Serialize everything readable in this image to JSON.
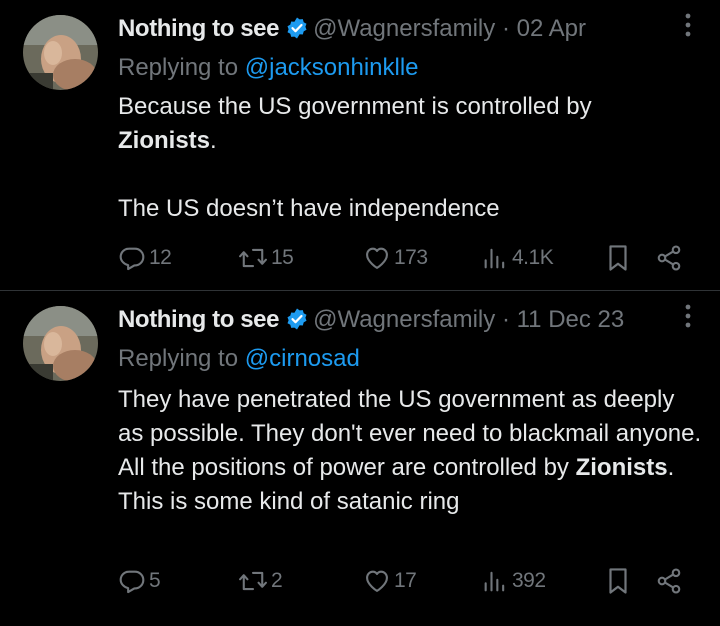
{
  "tweets": [
    {
      "author_name": "Nothing to see",
      "handle": "@Wagnersfamily",
      "separator": "·",
      "date": "02 Apr",
      "reply_prefix": "Replying to",
      "reply_to": "@jacksonhinklle",
      "body": {
        "line1": "Because the US government is controlled by",
        "bold": "Zionists",
        "after_bold": ".",
        "para2": "The US doesn’t have independence"
      },
      "stats": {
        "replies": "12",
        "reposts": "15",
        "likes": "173",
        "views": "4.1K"
      }
    },
    {
      "author_name": "Nothing to see",
      "handle": "@Wagnersfamily",
      "separator": "·",
      "date": "11 Dec 23",
      "reply_prefix": "Replying to",
      "reply_to": "@cirnosad",
      "body": {
        "before_bold": "They have penetrated the US government as deeply as possible. They don't ever need to blackmail anyone. All the positions of power are controlled by ",
        "bold": "Zionists",
        "after_bold": ". This is some kind of satanic ring"
      },
      "stats": {
        "replies": "5",
        "reposts": "2",
        "likes": "17",
        "views": "392"
      }
    }
  ],
  "icons": {
    "verified": "verified-badge-icon",
    "more": "more-options-icon",
    "reply": "reply-icon",
    "repost": "repost-icon",
    "like": "like-icon",
    "views": "views-icon",
    "bookmark": "bookmark-icon",
    "share": "share-icon"
  },
  "colors": {
    "background": "#000000",
    "text": "#e7e9ea",
    "muted": "#71767b",
    "accent": "#1d9bf0"
  }
}
